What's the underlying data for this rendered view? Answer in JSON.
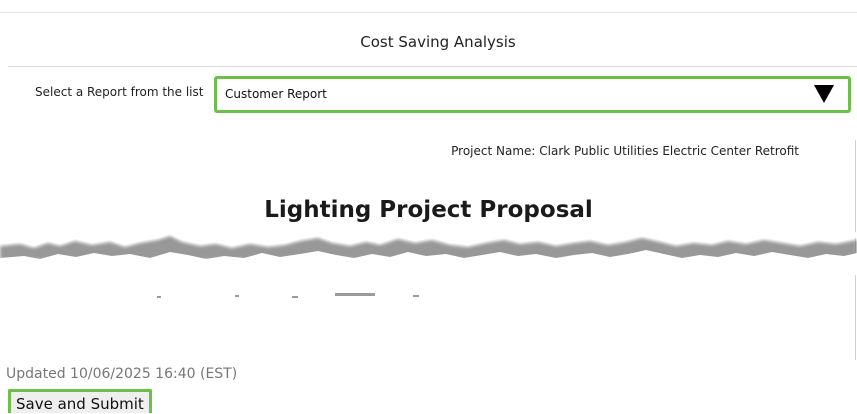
{
  "header": {
    "title": "Cost Saving Analysis"
  },
  "report_selector": {
    "label": "Select a Report from the list",
    "selected_value": "Customer Report",
    "arrow_icon": "triangle-down-icon",
    "highlight_color": "#6cc04a"
  },
  "preview": {
    "project_name": "Project Name: Clark Public Utilities Electric Center Retrofit",
    "document_title": "Lighting Project Proposal"
  },
  "footer": {
    "updated_text": "Updated 10/06/2025 16:40 (EST)",
    "submit_label": "Save and Submit"
  }
}
